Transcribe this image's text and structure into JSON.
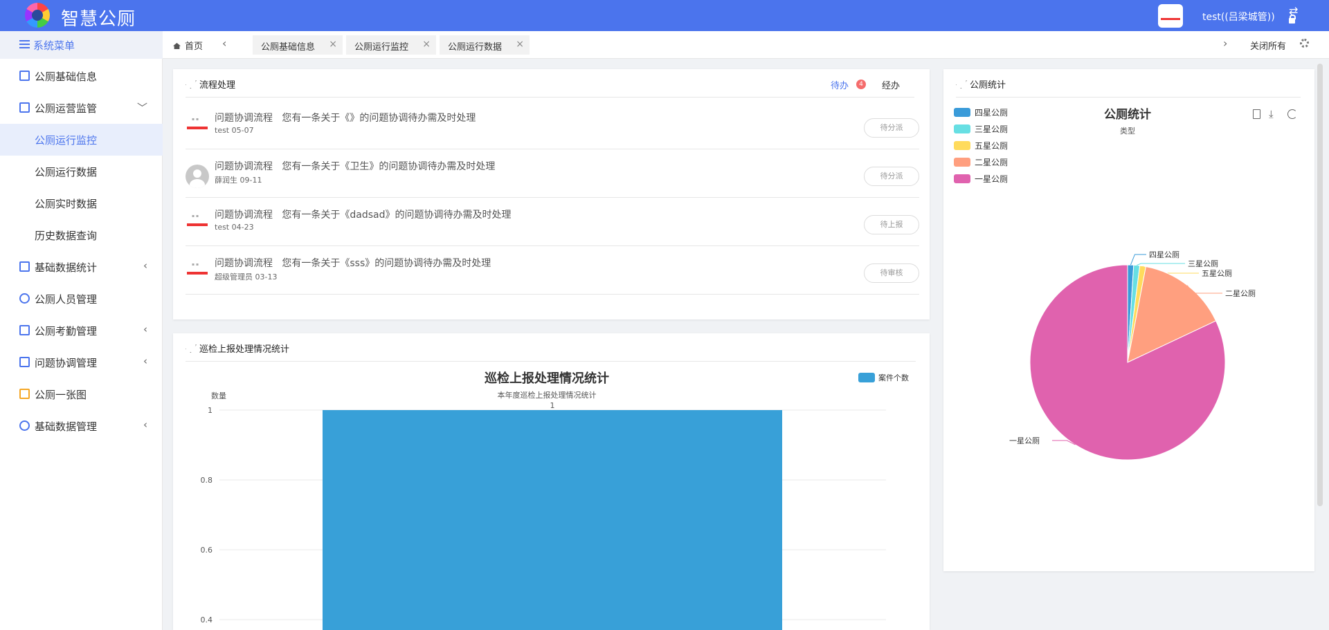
{
  "app": {
    "title": "智慧公厕",
    "user": "test((吕梁城管))",
    "swap_icon": "⇄"
  },
  "sidebar": {
    "header": "系统菜单",
    "items": [
      {
        "label": "公厕基础信息",
        "icon": "doc-icon",
        "color": "#4b74ed"
      },
      {
        "label": "公厕运营监管",
        "icon": "area-chart-icon",
        "color": "#4b74ed",
        "arrow": "﹀"
      },
      {
        "label": "公厕运行监控",
        "sub": true,
        "active": true
      },
      {
        "label": "公厕运行数据",
        "sub": true
      },
      {
        "label": "公厕实时数据",
        "sub": true
      },
      {
        "label": "历史数据查询",
        "sub": true
      },
      {
        "label": "基础数据统计",
        "icon": "bar-chart-icon",
        "color": "#4b74ed",
        "arrow": "‹"
      },
      {
        "label": "公厕人员管理",
        "icon": "user-icon",
        "color": "#4b74ed"
      },
      {
        "label": "公厕考勤管理",
        "icon": "calendar-icon",
        "color": "#4b74ed",
        "arrow": "‹"
      },
      {
        "label": "问题协调管理",
        "icon": "doc-icon",
        "color": "#4b74ed",
        "arrow": "‹"
      },
      {
        "label": "公厕一张图",
        "icon": "image-icon",
        "color": "#f5a623"
      },
      {
        "label": "基础数据管理",
        "icon": "gears-icon",
        "color": "#4b74ed",
        "arrow": "‹"
      }
    ]
  },
  "tabs": {
    "home": "首页",
    "prev": "‹",
    "next": "›",
    "items": [
      "公厕基础信息",
      "公厕运行监控",
      "公厕运行数据"
    ],
    "close": "×",
    "close_all": "关闭所有"
  },
  "process": {
    "title": "流程处理",
    "todo_tab": "待办",
    "todo_count": "4",
    "done_tab": "经办",
    "tasks": [
      {
        "text": "问题协调流程   您有一条关于《》的问题协调待办需及时处理",
        "meta": "test 05-07",
        "status": "待分派",
        "avatar": "red"
      },
      {
        "text": "问题协调流程   您有一条关于《卫生》的问题协调待办需及时处理",
        "meta": "薛润生 09-11",
        "status": "待分派",
        "avatar": "gray"
      },
      {
        "text": "问题协调流程   您有一条关于《dadsad》的问题协调待办需及时处理",
        "meta": "test 04-23",
        "status": "待上报",
        "avatar": "red"
      },
      {
        "text": "问题协调流程   您有一条关于《sss》的问题协调待办需及时处理",
        "meta": "超级管理员 03-13",
        "status": "待审核",
        "avatar": "red"
      }
    ]
  },
  "inspection": {
    "title": "巡检上报处理情况统计"
  },
  "stats": {
    "title": "公厕统计"
  },
  "chart_data": [
    {
      "type": "bar",
      "title": "巡检上报处理情况统计",
      "subtitle": "本年度巡检上报处理情况统计",
      "ylabel": "数量",
      "legend": "top-right",
      "series": [
        {
          "name": "案件个数",
          "values": [
            1
          ],
          "color": "#38a0d8"
        }
      ],
      "categories": [
        ""
      ],
      "data_labels": [
        "1"
      ],
      "yticks": [
        "1",
        "0.8",
        "0.6",
        "0.4"
      ],
      "ylim": [
        0,
        1
      ],
      "grid": true
    },
    {
      "type": "pie",
      "title": "公厕统计",
      "subtitle": "类型",
      "legend": "top-left",
      "labels": [
        "四星公厕",
        "三星公厕",
        "五星公厕",
        "二星公厕",
        "一星公厕"
      ],
      "values": [
        1,
        1,
        1,
        15,
        82
      ],
      "colors": [
        "#3a9bd9",
        "#67dfe3",
        "#ffdb5c",
        "#ff9f7f",
        "#e062ae"
      ]
    }
  ]
}
